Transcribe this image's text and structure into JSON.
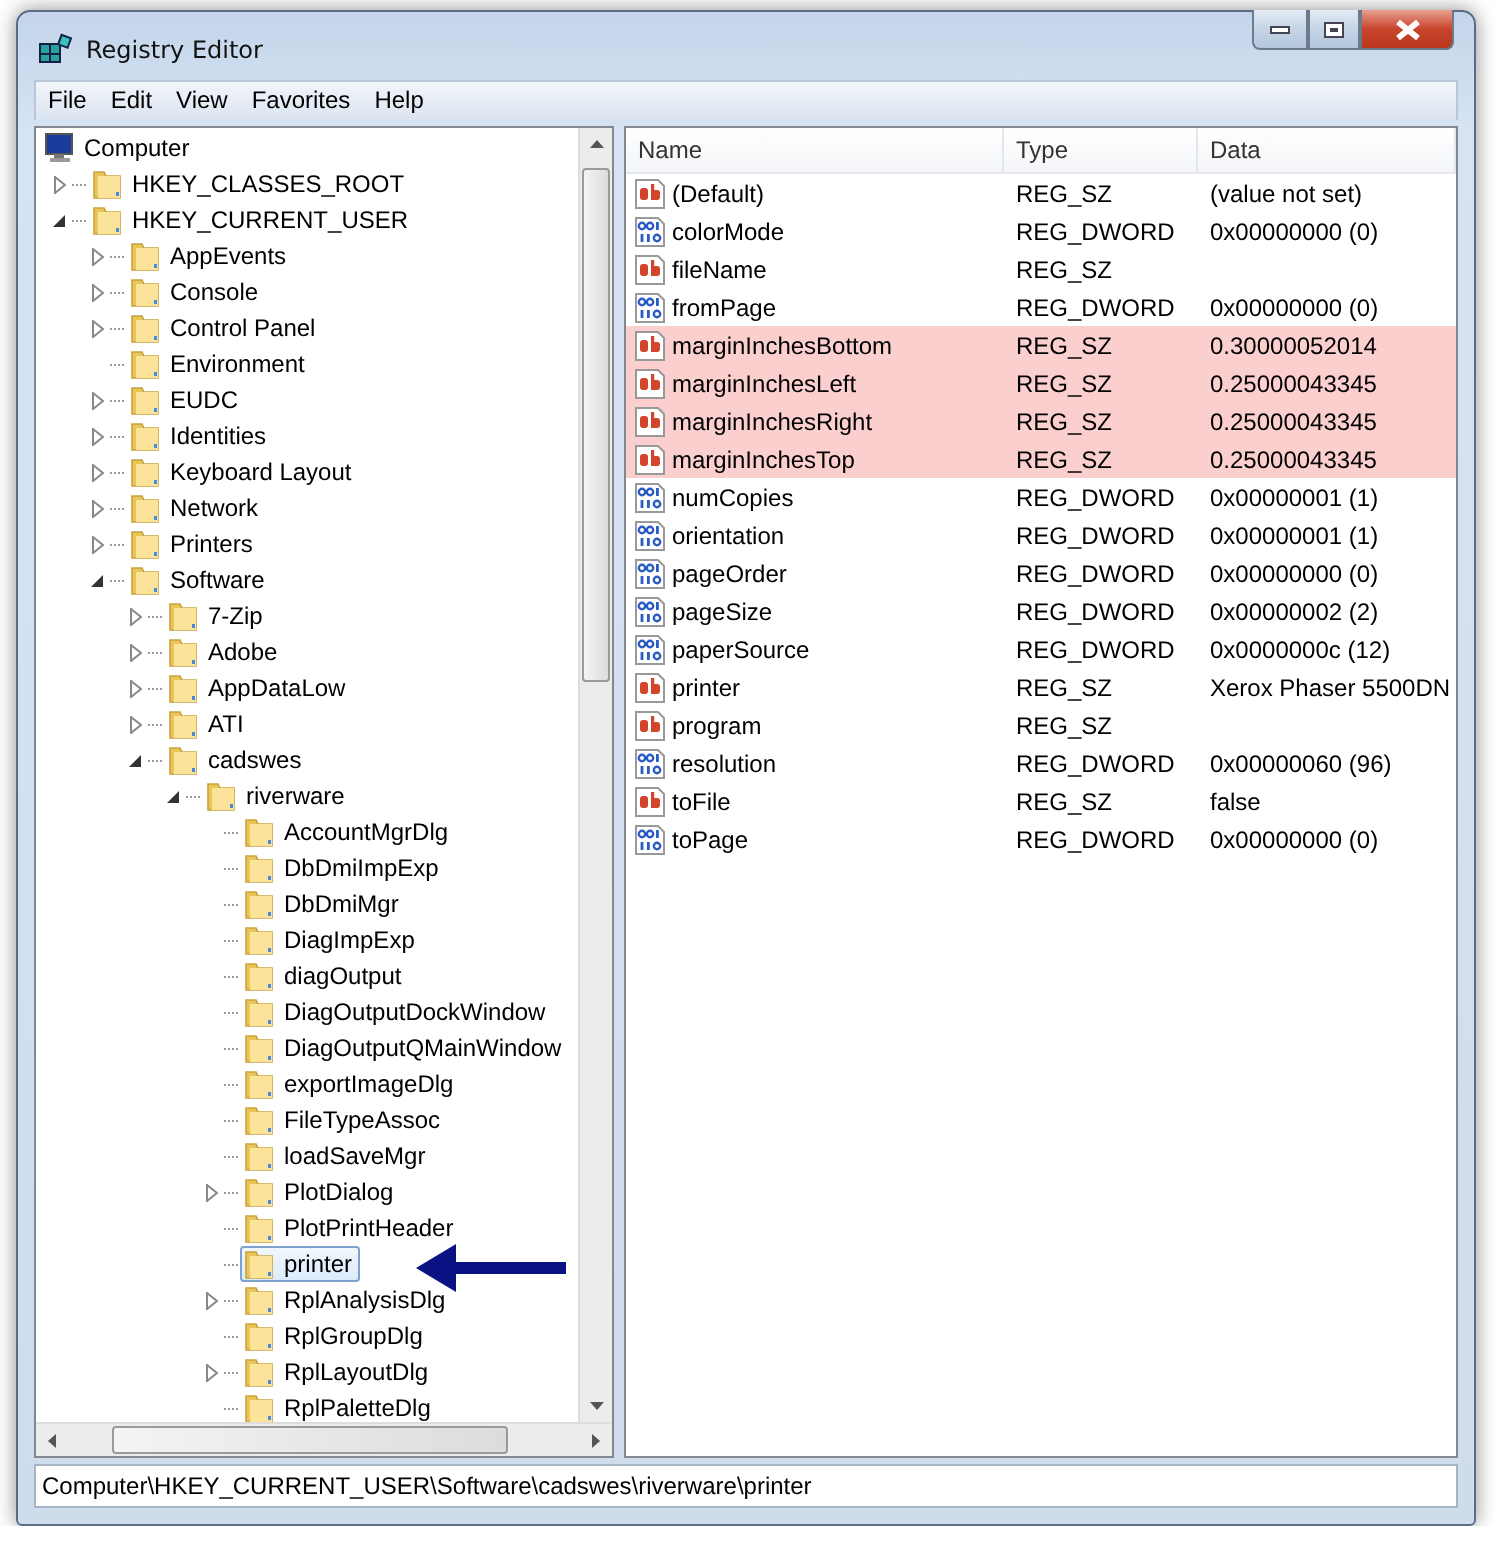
{
  "window": {
    "title": "Registry Editor"
  },
  "menu": [
    "File",
    "Edit",
    "View",
    "Favorites",
    "Help"
  ],
  "tree": [
    {
      "label": "Computer",
      "kind": "computer",
      "selected": false,
      "children": [
        {
          "label": "HKEY_CLASSES_ROOT",
          "kind": "folder",
          "expanded": false,
          "selected": false
        },
        {
          "label": "HKEY_CURRENT_USER",
          "kind": "folder",
          "expanded": true,
          "selected": false,
          "children": [
            {
              "label": "AppEvents",
              "kind": "folder",
              "expanded": false,
              "selected": false
            },
            {
              "label": "Console",
              "kind": "folder",
              "expanded": false,
              "selected": false
            },
            {
              "label": "Control Panel",
              "kind": "folder",
              "expanded": false,
              "selected": false
            },
            {
              "label": "Environment",
              "kind": "folder",
              "selected": false
            },
            {
              "label": "EUDC",
              "kind": "folder",
              "expanded": false,
              "selected": false
            },
            {
              "label": "Identities",
              "kind": "folder",
              "expanded": false,
              "selected": false
            },
            {
              "label": "Keyboard Layout",
              "kind": "folder",
              "expanded": false,
              "selected": false
            },
            {
              "label": "Network",
              "kind": "folder",
              "expanded": false,
              "selected": false
            },
            {
              "label": "Printers",
              "kind": "folder",
              "expanded": false,
              "selected": false
            },
            {
              "label": "Software",
              "kind": "folder",
              "expanded": true,
              "selected": false,
              "children": [
                {
                  "label": "7-Zip",
                  "kind": "folder",
                  "expanded": false,
                  "selected": false
                },
                {
                  "label": "Adobe",
                  "kind": "folder",
                  "expanded": false,
                  "selected": false
                },
                {
                  "label": "AppDataLow",
                  "kind": "folder",
                  "expanded": false,
                  "selected": false
                },
                {
                  "label": "ATI",
                  "kind": "folder",
                  "expanded": false,
                  "selected": false
                },
                {
                  "label": "cadswes",
                  "kind": "folder",
                  "expanded": true,
                  "selected": false,
                  "children": [
                    {
                      "label": "riverware",
                      "kind": "folder",
                      "expanded": true,
                      "selected": false,
                      "children": [
                        {
                          "label": "AccountMgrDlg",
                          "kind": "folder",
                          "selected": false
                        },
                        {
                          "label": "DbDmiImpExp",
                          "kind": "folder",
                          "selected": false
                        },
                        {
                          "label": "DbDmiMgr",
                          "kind": "folder",
                          "selected": false
                        },
                        {
                          "label": "DiagImpExp",
                          "kind": "folder",
                          "selected": false
                        },
                        {
                          "label": "diagOutput",
                          "kind": "folder",
                          "selected": false
                        },
                        {
                          "label": "DiagOutputDockWindow",
                          "kind": "folder",
                          "selected": false
                        },
                        {
                          "label": "DiagOutputQMainWindow",
                          "kind": "folder",
                          "selected": false
                        },
                        {
                          "label": "exportImageDlg",
                          "kind": "folder",
                          "selected": false
                        },
                        {
                          "label": "FileTypeAssoc",
                          "kind": "folder",
                          "selected": false
                        },
                        {
                          "label": "loadSaveMgr",
                          "kind": "folder",
                          "selected": false
                        },
                        {
                          "label": "PlotDialog",
                          "kind": "folder",
                          "expanded": false,
                          "selected": false
                        },
                        {
                          "label": "PlotPrintHeader",
                          "kind": "folder",
                          "selected": false
                        },
                        {
                          "label": "printer",
                          "kind": "folder",
                          "selected": true
                        },
                        {
                          "label": "RplAnalysisDlg",
                          "kind": "folder",
                          "expanded": false,
                          "selected": false
                        },
                        {
                          "label": "RplGroupDlg",
                          "kind": "folder",
                          "selected": false
                        },
                        {
                          "label": "RplLayoutDlg",
                          "kind": "folder",
                          "expanded": false,
                          "selected": false
                        },
                        {
                          "label": "RplPaletteDlg",
                          "kind": "folder",
                          "selected": false
                        }
                      ]
                    }
                  ]
                }
              ]
            }
          ]
        }
      ]
    }
  ],
  "table": {
    "columns": [
      "Name",
      "Type",
      "Data"
    ],
    "rows": [
      {
        "kind": "string",
        "name": "(Default)",
        "type": "REG_SZ",
        "data": "(value not set)",
        "highlighted": false
      },
      {
        "kind": "dword",
        "name": "colorMode",
        "type": "REG_DWORD",
        "data": "0x00000000 (0)",
        "highlighted": false
      },
      {
        "kind": "string",
        "name": "fileName",
        "type": "REG_SZ",
        "highlighted": false
      },
      {
        "kind": "dword",
        "name": "fromPage",
        "type": "REG_DWORD",
        "data": "0x00000000 (0)",
        "highlighted": false
      },
      {
        "kind": "string",
        "name": "marginInchesBottom",
        "type": "REG_SZ",
        "data": "0.30000052014",
        "highlighted": true
      },
      {
        "kind": "string",
        "name": "marginInchesLeft",
        "type": "REG_SZ",
        "data": "0.25000043345",
        "highlighted": true
      },
      {
        "kind": "string",
        "name": "marginInchesRight",
        "type": "REG_SZ",
        "data": "0.25000043345",
        "highlighted": true
      },
      {
        "kind": "string",
        "name": "marginInchesTop",
        "type": "REG_SZ",
        "data": "0.25000043345",
        "highlighted": true
      },
      {
        "kind": "dword",
        "name": "numCopies",
        "type": "REG_DWORD",
        "data": "0x00000001 (1)",
        "highlighted": false
      },
      {
        "kind": "dword",
        "name": "orientation",
        "type": "REG_DWORD",
        "data": "0x00000001 (1)",
        "highlighted": false
      },
      {
        "kind": "dword",
        "name": "pageOrder",
        "type": "REG_DWORD",
        "data": "0x00000000 (0)",
        "highlighted": false
      },
      {
        "kind": "dword",
        "name": "pageSize",
        "type": "REG_DWORD",
        "data": "0x00000002 (2)",
        "highlighted": false
      },
      {
        "kind": "dword",
        "name": "paperSource",
        "type": "REG_DWORD",
        "data": "0x0000000c (12)",
        "highlighted": false
      },
      {
        "kind": "string",
        "name": "printer",
        "type": "REG_SZ",
        "data": "Xerox Phaser 5500DN",
        "highlighted": false
      },
      {
        "kind": "string",
        "name": "program",
        "type": "REG_SZ",
        "highlighted": false
      },
      {
        "kind": "dword",
        "name": "resolution",
        "type": "REG_DWORD",
        "data": "0x00000060 (96)",
        "highlighted": false
      },
      {
        "kind": "string",
        "name": "toFile",
        "type": "REG_SZ",
        "data": "false",
        "highlighted": false
      },
      {
        "kind": "dword",
        "name": "toPage",
        "type": "REG_DWORD",
        "data": "0x00000000 (0)",
        "highlighted": false
      }
    ]
  },
  "status_bar": "Computer\\HKEY_CURRENT_USER\\Software\\cadswes\\riverware\\printer"
}
